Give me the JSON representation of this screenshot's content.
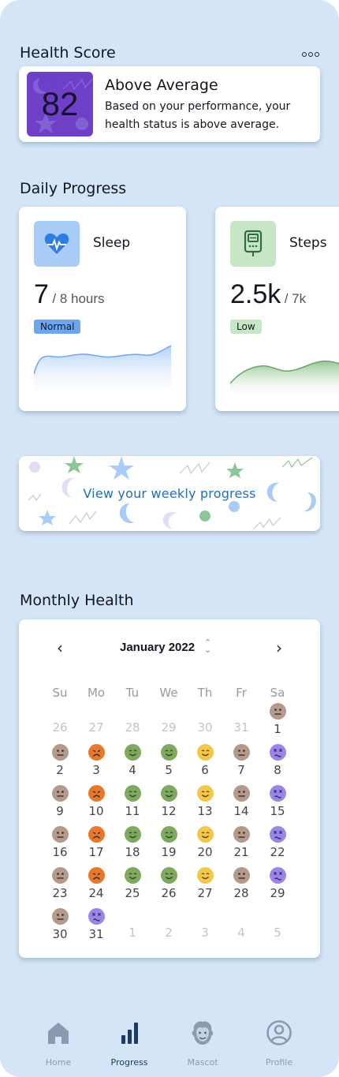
{
  "health": {
    "title": "Health Score",
    "score": "82",
    "headline": "Above Average",
    "description": "Based on your performance, your health status is above average."
  },
  "daily": {
    "title": "Daily Progress",
    "cards": [
      {
        "label": "Sleep",
        "value": "7",
        "unit": "/ 8 hours",
        "status": "Normal",
        "icon": "heart-pulse-icon",
        "color": "#6da6f0"
      },
      {
        "label": "Steps",
        "value": "2.5k",
        "unit": "/ 7k",
        "status": "Low",
        "icon": "step-counter-icon",
        "color": "#6aa66f"
      }
    ]
  },
  "weekly": {
    "label": "View  your weekly progress"
  },
  "monthly": {
    "title": "Monthly Health",
    "month": "January 2022",
    "weekdays": [
      "Su",
      "Mo",
      "Tu",
      "We",
      "Th",
      "Fr",
      "Sa"
    ],
    "days": [
      {
        "d": "26",
        "muted": true
      },
      {
        "d": "27",
        "muted": true
      },
      {
        "d": "28",
        "muted": true
      },
      {
        "d": "29",
        "muted": true
      },
      {
        "d": "30",
        "muted": true
      },
      {
        "d": "31",
        "muted": true
      },
      {
        "d": "1",
        "mood": "neutral"
      },
      {
        "d": "2",
        "mood": "neutral"
      },
      {
        "d": "3",
        "mood": "sad"
      },
      {
        "d": "4",
        "mood": "happy"
      },
      {
        "d": "5",
        "mood": "happy"
      },
      {
        "d": "6",
        "mood": "joyful"
      },
      {
        "d": "7",
        "mood": "neutral"
      },
      {
        "d": "8",
        "mood": "sick"
      },
      {
        "d": "9",
        "mood": "neutral"
      },
      {
        "d": "10",
        "mood": "sad"
      },
      {
        "d": "11",
        "mood": "happy"
      },
      {
        "d": "12",
        "mood": "happy"
      },
      {
        "d": "13",
        "mood": "joyful"
      },
      {
        "d": "14",
        "mood": "neutral"
      },
      {
        "d": "15",
        "mood": "sick"
      },
      {
        "d": "16",
        "mood": "neutral"
      },
      {
        "d": "17",
        "mood": "sad"
      },
      {
        "d": "18",
        "mood": "happy"
      },
      {
        "d": "19",
        "mood": "happy"
      },
      {
        "d": "20",
        "mood": "joyful"
      },
      {
        "d": "21",
        "mood": "neutral"
      },
      {
        "d": "22",
        "mood": "sick"
      },
      {
        "d": "23",
        "mood": "neutral"
      },
      {
        "d": "24",
        "mood": "sad"
      },
      {
        "d": "25",
        "mood": "happy"
      },
      {
        "d": "26",
        "mood": "happy"
      },
      {
        "d": "27",
        "mood": "joyful"
      },
      {
        "d": "28",
        "mood": "neutral"
      },
      {
        "d": "29",
        "mood": "sick"
      },
      {
        "d": "30",
        "mood": "neutral"
      },
      {
        "d": "31",
        "mood": "sick"
      },
      {
        "d": "1",
        "muted": true
      },
      {
        "d": "2",
        "muted": true
      },
      {
        "d": "3",
        "muted": true
      },
      {
        "d": "4",
        "muted": true
      },
      {
        "d": "5",
        "muted": true
      }
    ],
    "mood_colors": {
      "neutral": "#b49a8d",
      "sad": "#e8792a",
      "happy": "#7fa860",
      "joyful": "#f2c84b",
      "sick": "#9b86e8"
    }
  },
  "nav": {
    "items": [
      {
        "label": "Home",
        "icon": "home-icon",
        "active": false
      },
      {
        "label": "Progress",
        "icon": "bar-chart-icon",
        "active": true
      },
      {
        "label": "Mascot",
        "icon": "mascot-icon",
        "active": false
      },
      {
        "label": "Profile",
        "icon": "profile-icon",
        "active": false
      }
    ]
  },
  "colors": {
    "background": "#d3e5f6",
    "accent": "#1f6fb8",
    "score_badge": "#6e3fc7"
  }
}
